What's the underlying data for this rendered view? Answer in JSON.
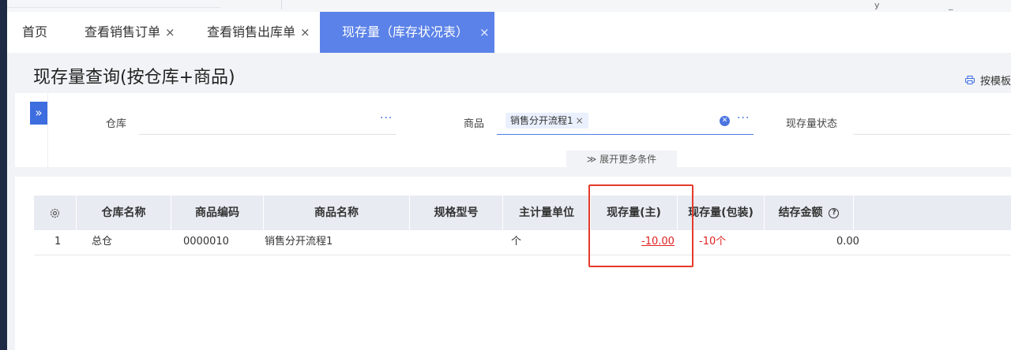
{
  "top_marks": [
    "y",
    "_"
  ],
  "tabs": [
    {
      "label": "首页",
      "closable": false
    },
    {
      "label": "查看销售订单",
      "closable": true,
      "close": "×"
    },
    {
      "label": "查看销售出库单",
      "closable": true,
      "close": "×"
    },
    {
      "label": "现存量（库存状况表）",
      "closable": true,
      "close": "×",
      "active": true
    }
  ],
  "page": {
    "title": "现存量查询(按仓库+商品)",
    "print_label": "按模板"
  },
  "filters": {
    "expander": "»",
    "warehouse_label": "仓库",
    "warehouse_dots": "···",
    "goods_label": "商品",
    "goods_value": "销售分开流程1",
    "goods_chip_close": "×",
    "goods_clear": "✕",
    "goods_dots": "···",
    "status_label": "现存量状态",
    "more_label": "≫ 展开更多条件"
  },
  "table": {
    "headers": [
      "仓库名称",
      "商品编码",
      "商品名称",
      "规格型号",
      "主计量单位",
      "现存量(主)",
      "现存量(包装)",
      "结存金额"
    ],
    "help_icon": "?",
    "rows": [
      {
        "index": "1",
        "warehouse": "总仓",
        "code": "0000010",
        "name": "销售分开流程1",
        "spec": "",
        "unit": "个",
        "qty_main": "-10.00",
        "qty_pack": "-10个",
        "amount": "0.00"
      }
    ]
  },
  "colors": {
    "accent": "#3d6ddf",
    "active_tab": "#5b82e8",
    "negative": "#e02020",
    "highlight_box": "#e53a2a"
  }
}
